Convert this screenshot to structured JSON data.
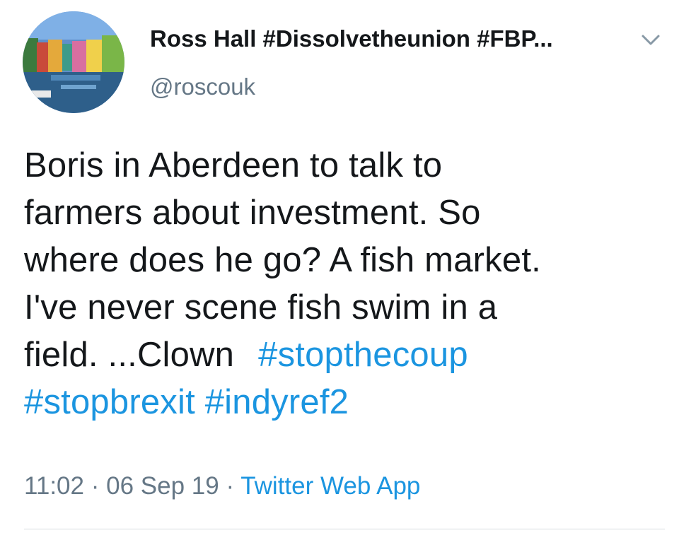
{
  "tweet": {
    "author_name": "Ross Hall #Dissolvetheunion #FBP...",
    "author_handle": "@roscouk",
    "text_lines": [
      "Boris in Aberdeen to talk to",
      "farmers about investment. So",
      "where does he go? A fish market.",
      "I've never scene fish swim in a",
      "field. ...Clown"
    ],
    "hashtags": [
      "#stopthecoup",
      "#stopbrexit",
      "#indyref2"
    ],
    "time": "11:02",
    "date": "06 Sep 19",
    "separator": "·",
    "source": "Twitter Web App",
    "menu_icon": "chevron-down-icon",
    "colors": {
      "text": "#14171a",
      "secondary": "#657786",
      "link": "#1b95e0"
    }
  }
}
